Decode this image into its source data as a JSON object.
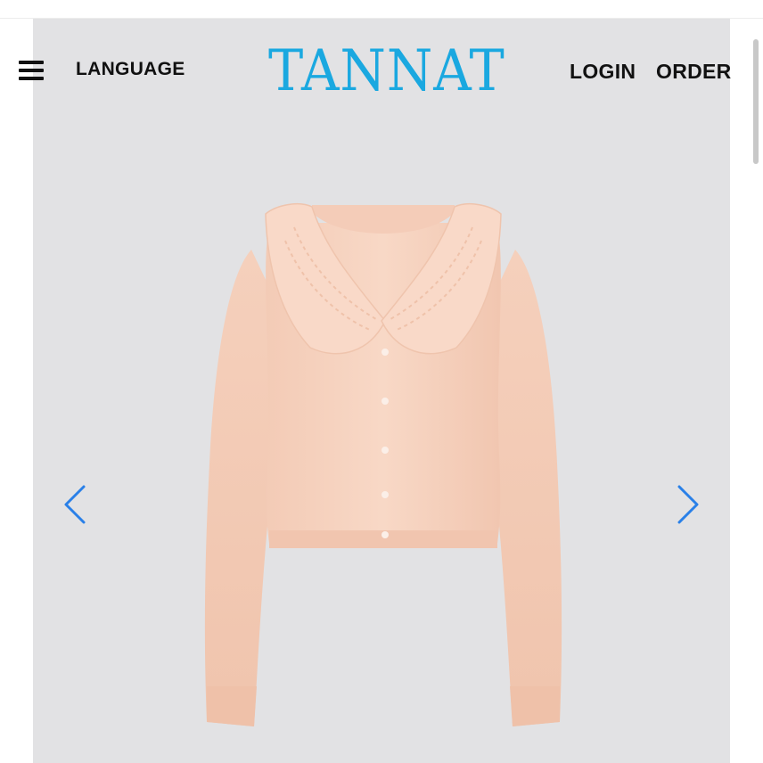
{
  "header": {
    "menu_icon": "hamburger-menu-icon",
    "language_label": "LANGUAGE",
    "logo_text": "TANNAT",
    "login_label": "LOGIN",
    "order_label": "ORDER"
  },
  "colors": {
    "brand": "#1aa8e0",
    "hero_background": "#e2e2e4",
    "arrow": "#2a80e8",
    "nav_text": "#111111",
    "product": "#f6d3c0"
  },
  "carousel": {
    "prev_icon": "chevron-left-icon",
    "next_icon": "chevron-right-icon",
    "product_image": "peach-collared-knit-cardigan"
  }
}
